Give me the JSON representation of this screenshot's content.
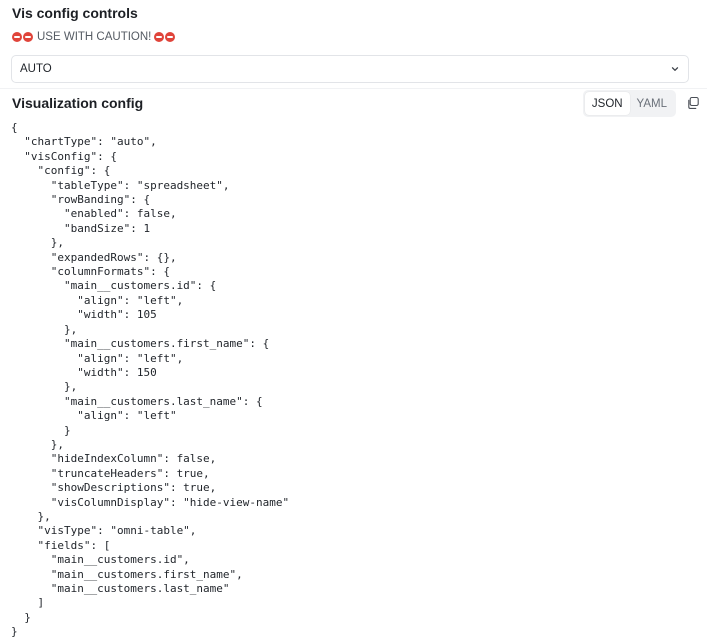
{
  "controls": {
    "title": "Vis config controls",
    "caution_text": "USE WITH CAUTION!",
    "select_value": "AUTO"
  },
  "config_panel": {
    "title": "Visualization config",
    "formats": [
      "JSON",
      "YAML"
    ],
    "active_format": "JSON"
  },
  "code_lines": [
    "{",
    "  \"chartType\": \"auto\",",
    "  \"visConfig\": {",
    "    \"config\": {",
    "      \"tableType\": \"spreadsheet\",",
    "      \"rowBanding\": {",
    "        \"enabled\": false,",
    "        \"bandSize\": 1",
    "      },",
    "      \"expandedRows\": {},",
    "      \"columnFormats\": {",
    "        \"main__customers.id\": {",
    "          \"align\": \"left\",",
    "          \"width\": 105",
    "        },",
    "        \"main__customers.first_name\": {",
    "          \"align\": \"left\",",
    "          \"width\": 150",
    "        },",
    "        \"main__customers.last_name\": {",
    "          \"align\": \"left\"",
    "        }",
    "      },",
    "      \"hideIndexColumn\": false,",
    "      \"truncateHeaders\": true,",
    "      \"showDescriptions\": true,",
    "      \"visColumnDisplay\": \"hide-view-name\"",
    "    },",
    "    \"visType\": \"omni-table\",",
    "    \"fields\": [",
    "      \"main__customers.id\",",
    "      \"main__customers.first_name\",",
    "      \"main__customers.last_name\"",
    "    ]",
    "  }",
    "}"
  ],
  "icons": {
    "caution": "no-entry-icon",
    "select": "chevron-down-icon",
    "copy": "copy-icon"
  },
  "colors": {
    "caution_red": "#e0443a",
    "segment_bg": "#f1f2f4"
  }
}
